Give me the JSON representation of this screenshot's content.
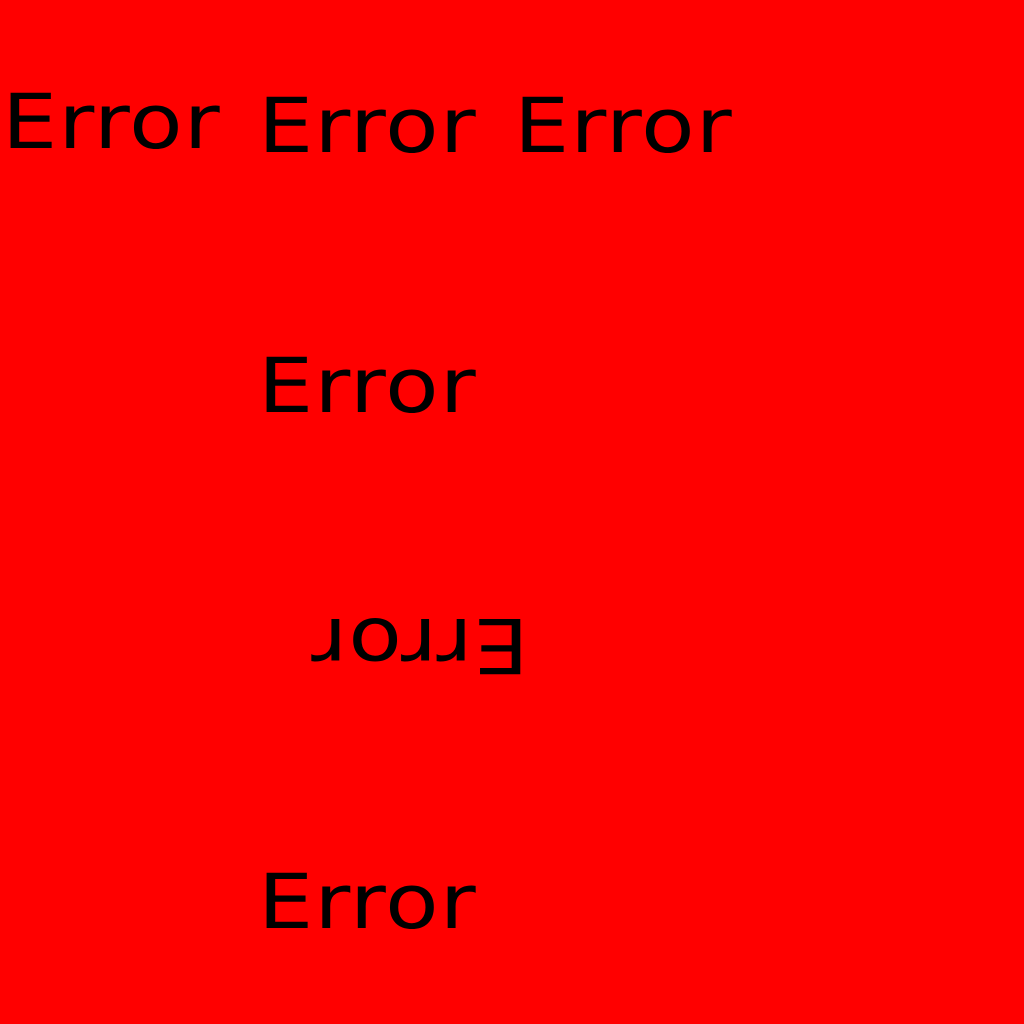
{
  "background_color": "#ff0000",
  "text_color": "#000000",
  "messages": [
    {
      "text": "Error"
    },
    {
      "text": "Error"
    },
    {
      "text": "Error"
    },
    {
      "text": "Error"
    },
    {
      "text": "Error"
    },
    {
      "text": "Error"
    }
  ]
}
